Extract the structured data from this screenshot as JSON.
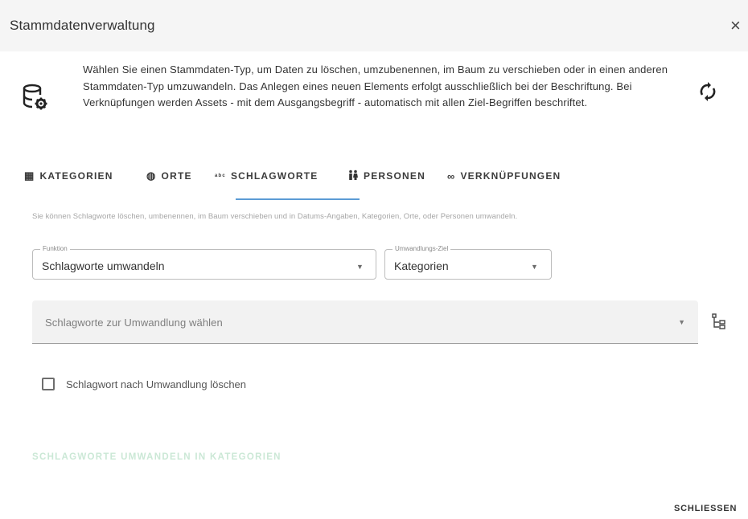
{
  "dialog": {
    "title": "Stammdatenverwaltung",
    "close_glyph": "×"
  },
  "info": {
    "icon": "database-settings-icon",
    "text": "Wählen Sie einen Stammdaten-Typ, um Daten zu löschen, umzubenennen, im Baum zu verschieben oder in einen anderen Stammdaten-Typ umzuwandeln. Das Anlegen eines neuen Elements erfolgt ausschließlich bei der Beschriftung. Bei Verknüpfungen werden Assets - mit dem Ausgangsbegriff - automatisch mit allen Ziel-Begriffen beschriftet.",
    "refresh_icon": "sync-icon"
  },
  "tabs": [
    {
      "label": "KATEGORIEN",
      "icon": "table-icon",
      "glyph": "▦"
    },
    {
      "label": "ORTE",
      "icon": "globe-icon",
      "glyph": "◍"
    },
    {
      "label": "SCHLAGWORTE",
      "icon": "tag-text-icon",
      "glyph": "ᵃᵇᶜ"
    },
    {
      "label": "PERSONEN",
      "icon": "people-icon",
      "glyph": "🚻"
    },
    {
      "label": "VERKNÜPFUNGEN",
      "icon": "link-icon",
      "glyph": "∞"
    }
  ],
  "active_tab": "SCHLAGWORTE",
  "hint": "Sie können Schlagworte löschen, umbenennen, im Baum verschieben und in Datums-Angaben, Kategorien, Orte, oder Personen umwandeln.",
  "form": {
    "function_label": "Funktion",
    "function_value": "Schlagworte umwandeln",
    "target_label": "Umwandlungs-Ziel",
    "target_value": "Kategorien",
    "keyword_select_placeholder": "Schlagworte zur Umwandlung wählen",
    "delete_after_label": "Schlagwort nach Umwandlung löschen",
    "delete_after_checked": false,
    "action_label": "SCHLAGWORTE UMWANDELN IN KATEGORIEN"
  },
  "footer": {
    "close_label": "SCHLIESSEN"
  },
  "colors": {
    "accent": "#5b9bd5",
    "action_disabled": "#cbe8d6",
    "titlebar": "#f5f5f5"
  }
}
